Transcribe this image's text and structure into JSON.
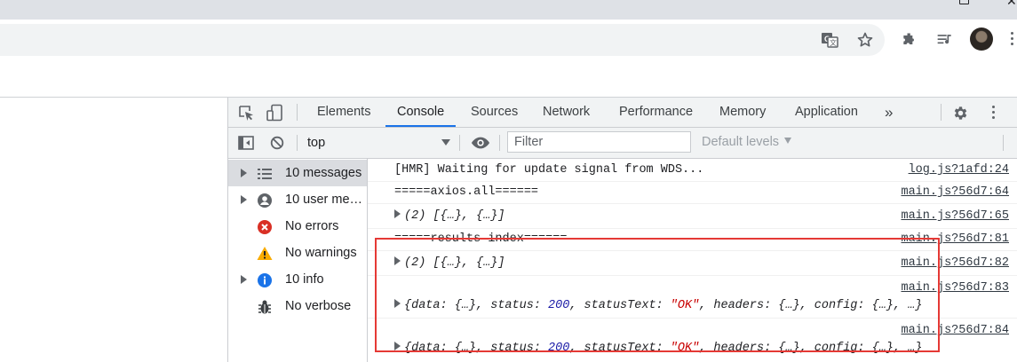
{
  "browser": {
    "icons": [
      "restore-icon",
      "close-icon",
      "translate-icon",
      "bookmark-star-icon",
      "extensions-icon",
      "media-queue-icon",
      "profile-avatar",
      "chrome-menu-icon"
    ]
  },
  "devtools": {
    "tabs": [
      {
        "label": "Elements"
      },
      {
        "label": "Console",
        "active": true
      },
      {
        "label": "Sources"
      },
      {
        "label": "Network"
      },
      {
        "label": "Performance"
      },
      {
        "label": "Memory"
      },
      {
        "label": "Application"
      }
    ],
    "more_tabs": "»",
    "console_toolbar": {
      "context": "top",
      "filter_placeholder": "Filter",
      "levels": "Default levels"
    },
    "sidebar": [
      {
        "label": "10 messages",
        "icon": "list-icon",
        "expandable": true,
        "selected": true
      },
      {
        "label": "10 user mes...",
        "icon": "user-icon",
        "expandable": true
      },
      {
        "label": "No errors",
        "icon": "error-icon",
        "expandable": false
      },
      {
        "label": "No warnings",
        "icon": "warning-icon",
        "expandable": false
      },
      {
        "label": "10 info",
        "icon": "info-icon",
        "expandable": true
      },
      {
        "label": "No verbose",
        "icon": "bug-icon",
        "expandable": false
      }
    ],
    "messages": [
      {
        "text": "[HMR] Waiting for update signal from WDS...",
        "source": "log.js?1afd:24"
      },
      {
        "text": "=====axios.all======",
        "source": "main.js?56d7:64"
      },
      {
        "text": "(2) [{…}, {…}]",
        "source": "main.js?56d7:65"
      },
      {
        "text": "=====results index======",
        "source": "main.js?56d7:81"
      },
      {
        "text": "(2) [{…}, {…}]",
        "source": "main.js?56d7:82"
      },
      {
        "source": "main.js?56d7:83",
        "obj": {
          "a": "{data: {…}, status: ",
          "num": "200",
          "b": ", statusText: ",
          "str": "\"OK\"",
          "c": ", headers: {…}, config: {…}, …}"
        }
      },
      {
        "source": "main.js?56d7:84",
        "obj": {
          "a": "{data: {…}, status: ",
          "num": "200",
          "b": ", statusText: ",
          "str": "\"OK\"",
          "c": ", headers: {…}, config: {…}, …}"
        }
      }
    ]
  },
  "colors": {
    "accent": "#1a73e8",
    "highlight": "#e53935",
    "error": "#d93025",
    "warning": "#f9ab00",
    "info": "#1a73e8"
  }
}
